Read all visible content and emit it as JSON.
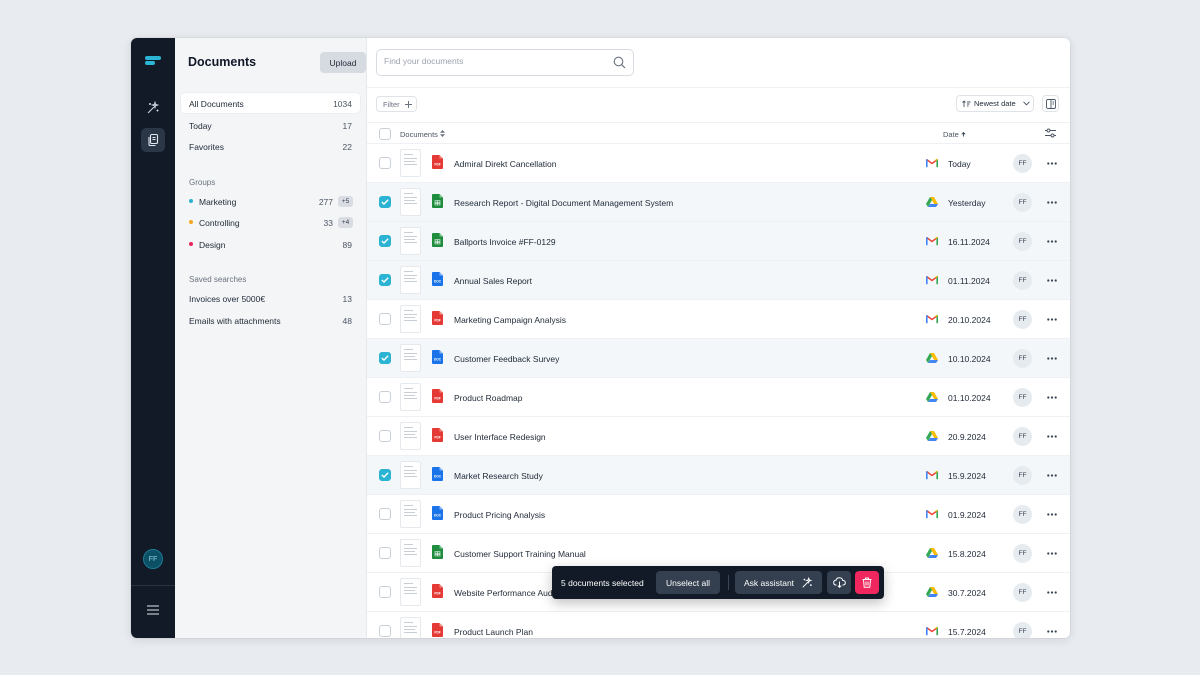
{
  "sidebar": {
    "title": "Documents",
    "upload_label": "Upload",
    "items": [
      {
        "label": "All Documents",
        "count": "1034"
      },
      {
        "label": "Today",
        "count": "17"
      },
      {
        "label": "Favorites",
        "count": "22"
      }
    ],
    "groups_heading": "Groups",
    "groups": [
      {
        "label": "Marketing",
        "count": "277",
        "badge": "+5",
        "color": "#2bb3d3"
      },
      {
        "label": "Controlling",
        "count": "33",
        "badge": "+4",
        "color": "#f5a524"
      },
      {
        "label": "Design",
        "count": "89",
        "badge": "",
        "color": "#e8265e"
      }
    ],
    "saved_heading": "Saved searches",
    "saved": [
      {
        "label": "Invoices over 5000€",
        "count": "13"
      },
      {
        "label": "Emails with attachments",
        "count": "48"
      }
    ]
  },
  "rail": {
    "avatar_initials": "FF",
    "icons": [
      "logo-icon",
      "sparkle-icon",
      "documents-icon",
      "menu-icon"
    ]
  },
  "search": {
    "placeholder": "Find your documents",
    "value": ""
  },
  "toolbar": {
    "filter_label": "Filter",
    "sort_label": "Newest date"
  },
  "table": {
    "col_documents": "Documents",
    "col_date": "Date",
    "rows": [
      {
        "name": "Admiral Direkt Cancellation",
        "type": "pdf",
        "source": "gmail",
        "date": "Today",
        "owner": "FF",
        "selected": false
      },
      {
        "name": "Research Report - Digital Document Management System",
        "type": "sheet",
        "source": "drive",
        "date": "Yesterday",
        "owner": "FF",
        "selected": true
      },
      {
        "name": "Ballports Invoice #FF-0129",
        "type": "sheet",
        "source": "gmail",
        "date": "16.11.2024",
        "owner": "FF",
        "selected": true
      },
      {
        "name": "Annual Sales Report",
        "type": "doc",
        "source": "gmail",
        "date": "01.11.2024",
        "owner": "FF",
        "selected": true
      },
      {
        "name": "Marketing Campaign Analysis",
        "type": "pdf",
        "source": "gmail",
        "date": "20.10.2024",
        "owner": "FF",
        "selected": false
      },
      {
        "name": "Customer Feedback Survey",
        "type": "doc",
        "source": "drive",
        "date": "10.10.2024",
        "owner": "FF",
        "selected": true
      },
      {
        "name": "Product Roadmap",
        "type": "pdf",
        "source": "drive",
        "date": "01.10.2024",
        "owner": "FF",
        "selected": false
      },
      {
        "name": "User Interface Redesign",
        "type": "pdf",
        "source": "drive",
        "date": "20.9.2024",
        "owner": "FF",
        "selected": false
      },
      {
        "name": "Market Research Study",
        "type": "doc",
        "source": "gmail",
        "date": "15.9.2024",
        "owner": "FF",
        "selected": true
      },
      {
        "name": "Product Pricing Analysis",
        "type": "doc",
        "source": "gmail",
        "date": "01.9.2024",
        "owner": "FF",
        "selected": false
      },
      {
        "name": "Customer Support Training Manual",
        "type": "sheet",
        "source": "drive",
        "date": "15.8.2024",
        "owner": "FF",
        "selected": false
      },
      {
        "name": "Website Performance Audit",
        "type": "pdf",
        "source": "drive",
        "date": "30.7.2024",
        "owner": "FF",
        "selected": false
      },
      {
        "name": "Product Launch Plan",
        "type": "pdf",
        "source": "gmail",
        "date": "15.7.2024",
        "owner": "FF",
        "selected": false
      }
    ]
  },
  "action_bar": {
    "selected_text": "5 documents selected",
    "unselect_label": "Unselect all",
    "ask_label": "Ask assistant"
  },
  "colors": {
    "accent": "#2bb3d3",
    "rail_bg": "#111a26",
    "delete": "#f0275e",
    "pdf": "#e53935",
    "sheet": "#1e8e3e",
    "doc": "#1a73e8"
  }
}
